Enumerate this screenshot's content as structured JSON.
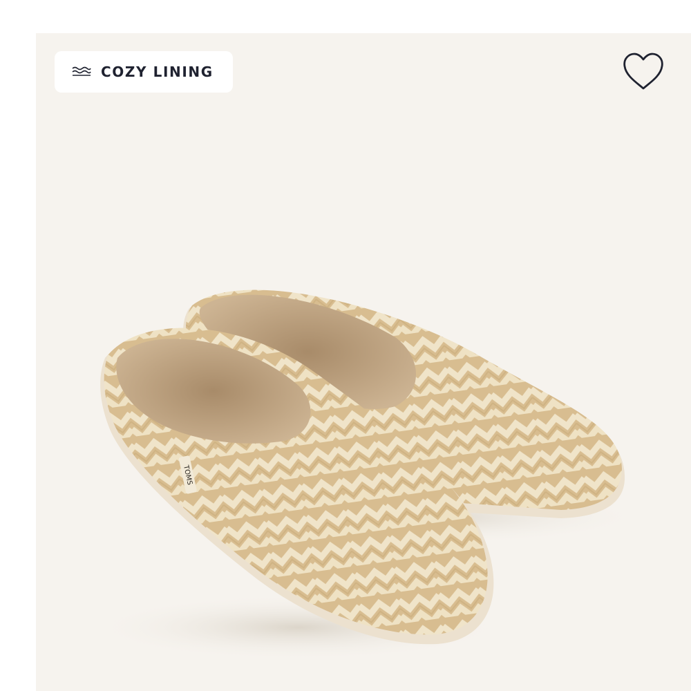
{
  "badge": {
    "label": "COZY LINING",
    "icon": "cozy-lining-waves-icon"
  },
  "wishlist": {
    "icon": "heart-outline-icon"
  },
  "product": {
    "brand_tag": "TOMS"
  },
  "colors": {
    "background": "#f6f3ee",
    "badge_bg": "#ffffff",
    "text_dark": "#1f2230",
    "shoe_tan": "#d9bf93",
    "shoe_cream": "#efe3c7",
    "sole": "#ece1cf",
    "lining": "#c3a887"
  }
}
